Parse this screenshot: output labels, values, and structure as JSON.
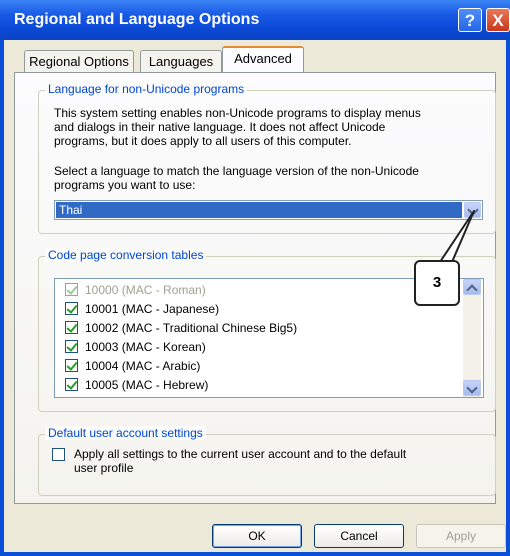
{
  "window": {
    "title": "Regional and Language Options",
    "help_glyph": "?",
    "close_glyph": "X"
  },
  "tabs": [
    {
      "label": "Regional Options",
      "active": false
    },
    {
      "label": "Languages",
      "active": false
    },
    {
      "label": "Advanced",
      "active": true
    }
  ],
  "non_unicode": {
    "legend": "Language for non-Unicode programs",
    "description_lines": [
      "This system setting enables non-Unicode programs to display menus",
      "and dialogs in their native language. It does not affect Unicode",
      "programs, but it does apply to all users of this computer."
    ],
    "prompt_lines": [
      "Select a language to match the language version of the non-Unicode",
      "programs you want to use:"
    ],
    "selected_language": "Thai"
  },
  "code_page": {
    "legend": "Code page conversion tables",
    "items": [
      {
        "label": "10000 (MAC - Roman)",
        "checked": true,
        "disabled": true
      },
      {
        "label": "10001 (MAC - Japanese)",
        "checked": true,
        "disabled": false
      },
      {
        "label": "10002 (MAC - Traditional Chinese Big5)",
        "checked": true,
        "disabled": false
      },
      {
        "label": "10003 (MAC - Korean)",
        "checked": true,
        "disabled": false
      },
      {
        "label": "10004 (MAC - Arabic)",
        "checked": true,
        "disabled": false
      },
      {
        "label": "10005 (MAC - Hebrew)",
        "checked": true,
        "disabled": false
      }
    ]
  },
  "default_user": {
    "legend": "Default user account settings",
    "apply_label_lines": [
      "Apply all settings to the current user account and to the default",
      "user profile"
    ],
    "checked": false
  },
  "buttons": {
    "ok": "OK",
    "cancel": "Cancel",
    "apply": "Apply"
  },
  "annotation": {
    "number": "3"
  },
  "colors": {
    "title_bar": "#0a4fd8",
    "selection": "#316ac5",
    "legend_text": "#0046d5",
    "check_green": "#21a121"
  }
}
